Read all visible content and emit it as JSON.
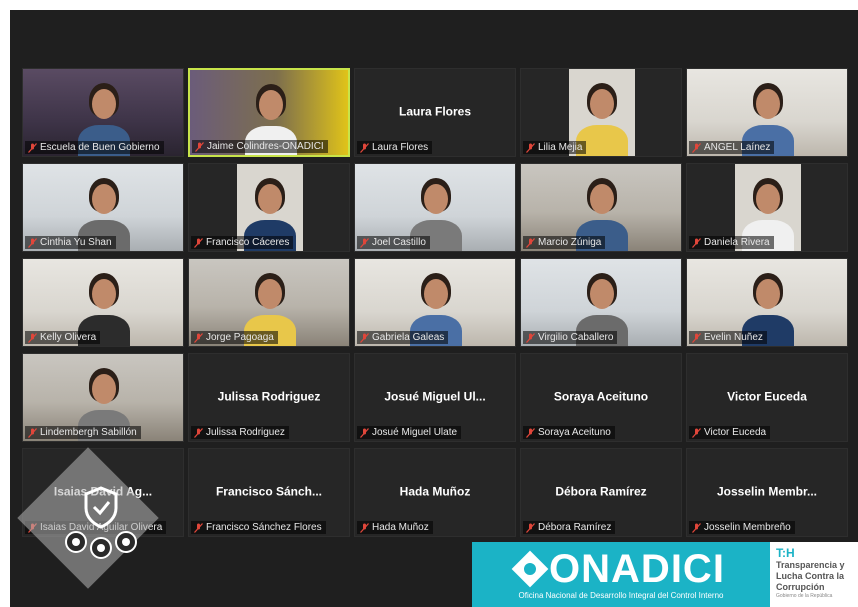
{
  "participants": [
    {
      "name": "Escuela de Buen Gobierno",
      "display": "",
      "video": "v-dark"
    },
    {
      "name": "Jaime Colindres-ONADICI",
      "display": "",
      "video": "v-yellow",
      "active": true
    },
    {
      "name": "Laura Flores",
      "display": "Laura Flores",
      "video": ""
    },
    {
      "name": "Lilia Mejia",
      "display": "",
      "video": "inset"
    },
    {
      "name": "ANGEL Laínez",
      "display": "",
      "video": "v-light"
    },
    {
      "name": "Cinthia Yu Shan",
      "display": "",
      "video": "v-office"
    },
    {
      "name": "Francisco Cáceres",
      "display": "",
      "video": "inset"
    },
    {
      "name": "Joel Castillo",
      "display": "",
      "video": "v-office"
    },
    {
      "name": "Marcio Zúniga",
      "display": "",
      "video": "v-room"
    },
    {
      "name": "Daniela Rivera",
      "display": "",
      "video": "inset"
    },
    {
      "name": "Kelly Olivera",
      "display": "",
      "video": "v-light"
    },
    {
      "name": "Jorge Pagoaga",
      "display": "",
      "video": "v-room"
    },
    {
      "name": "Gabriela Galeas",
      "display": "",
      "video": "v-light"
    },
    {
      "name": "Virgilio Caballero",
      "display": "",
      "video": "v-office"
    },
    {
      "name": "Evelin Nuñez",
      "display": "",
      "video": "v-light"
    },
    {
      "name": "Lindembergh Sabillón",
      "display": "",
      "video": "v-room"
    },
    {
      "name": "Julissa Rodriguez",
      "display": "Julissa Rodriguez",
      "video": ""
    },
    {
      "name": "Josué Miguel Ulate",
      "display": "Josué  Miguel  Ul...",
      "video": ""
    },
    {
      "name": "Soraya Aceituno",
      "display": "Soraya Aceituno",
      "video": ""
    },
    {
      "name": "Victor Euceda",
      "display": "Victor Euceda",
      "video": ""
    },
    {
      "name": "Isaias David Aguilar Olivera",
      "display": "Isaias David  Ag...",
      "video": ""
    },
    {
      "name": "Francisco Sánchez Flores",
      "display": "Francisco  Sánch...",
      "video": ""
    },
    {
      "name": "Hada Muñoz",
      "display": "Hada Muñoz",
      "video": ""
    },
    {
      "name": "Débora Ramírez",
      "display": "Débora Ramírez",
      "video": ""
    },
    {
      "name": "Josselin Membreño",
      "display": "Josselin  Membr...",
      "video": ""
    }
  ],
  "colors": {
    "mic_muted": "#e0463a",
    "active_border": "#c8e44a",
    "brand": "#1bb3c6"
  },
  "logo": {
    "name": "ONADICI",
    "subtitle": "Oficina Nacional de Desarrollo Integral del Control Interno"
  },
  "th_logo": {
    "mark": "T:H",
    "line1": "Transparencia y",
    "line2": "Lucha Contra la",
    "line3": "Corrupción",
    "small": "Gobierno de la República"
  },
  "icons": {
    "mic": "mic-muted-icon",
    "badge": "shield-gears-icon"
  }
}
